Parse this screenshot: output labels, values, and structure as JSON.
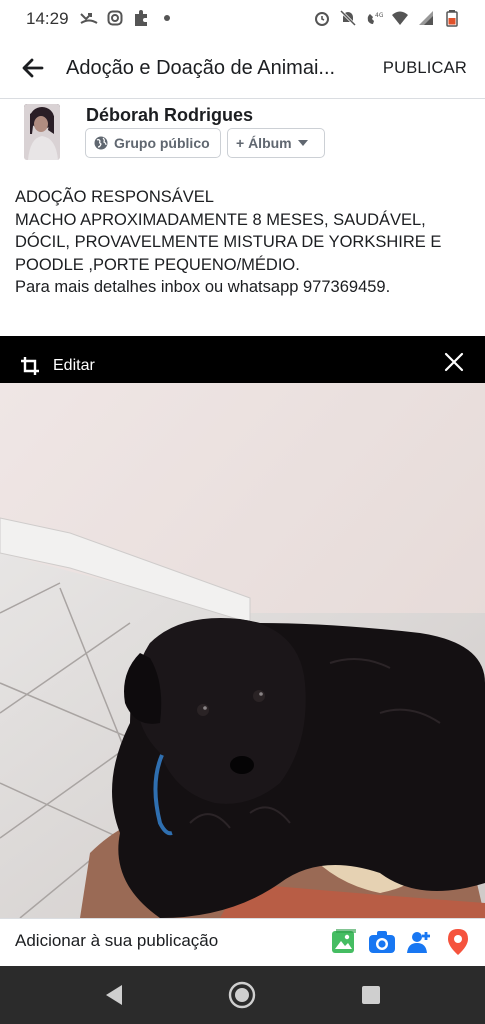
{
  "status_bar": {
    "time": "14:29"
  },
  "header": {
    "title": "Adoção e Doação de Animai...",
    "publish_label": "PUBLICAR"
  },
  "author": {
    "name": "Déborah Rodrigues",
    "audience_label": "Grupo público",
    "album_label": "+ Álbum"
  },
  "post": {
    "lines": [
      "ADOÇÃO RESPONSÁVEL",
      "MACHO APROXIMADAMENTE 8 MESES, SAUDÁVEL,",
      "DÓCIL, PROVAVELMENTE MISTURA DE YORKSHIRE E",
      "POODLE ,PORTE PEQUENO/MÉDIO.",
      "Para mais detalhes inbox ou whatsapp 977369459."
    ]
  },
  "photo": {
    "edit_label": "Editar"
  },
  "add_bar": {
    "label": "Adicionar à sua publicação",
    "icons": [
      "photo-icon",
      "camera-icon",
      "tag-people-icon",
      "location-icon"
    ]
  },
  "colors": {
    "accent_blue": "#1877f2",
    "photo_green": "#45bd62",
    "location_red": "#f5533d",
    "nav_bar": "#2b2b2b"
  }
}
